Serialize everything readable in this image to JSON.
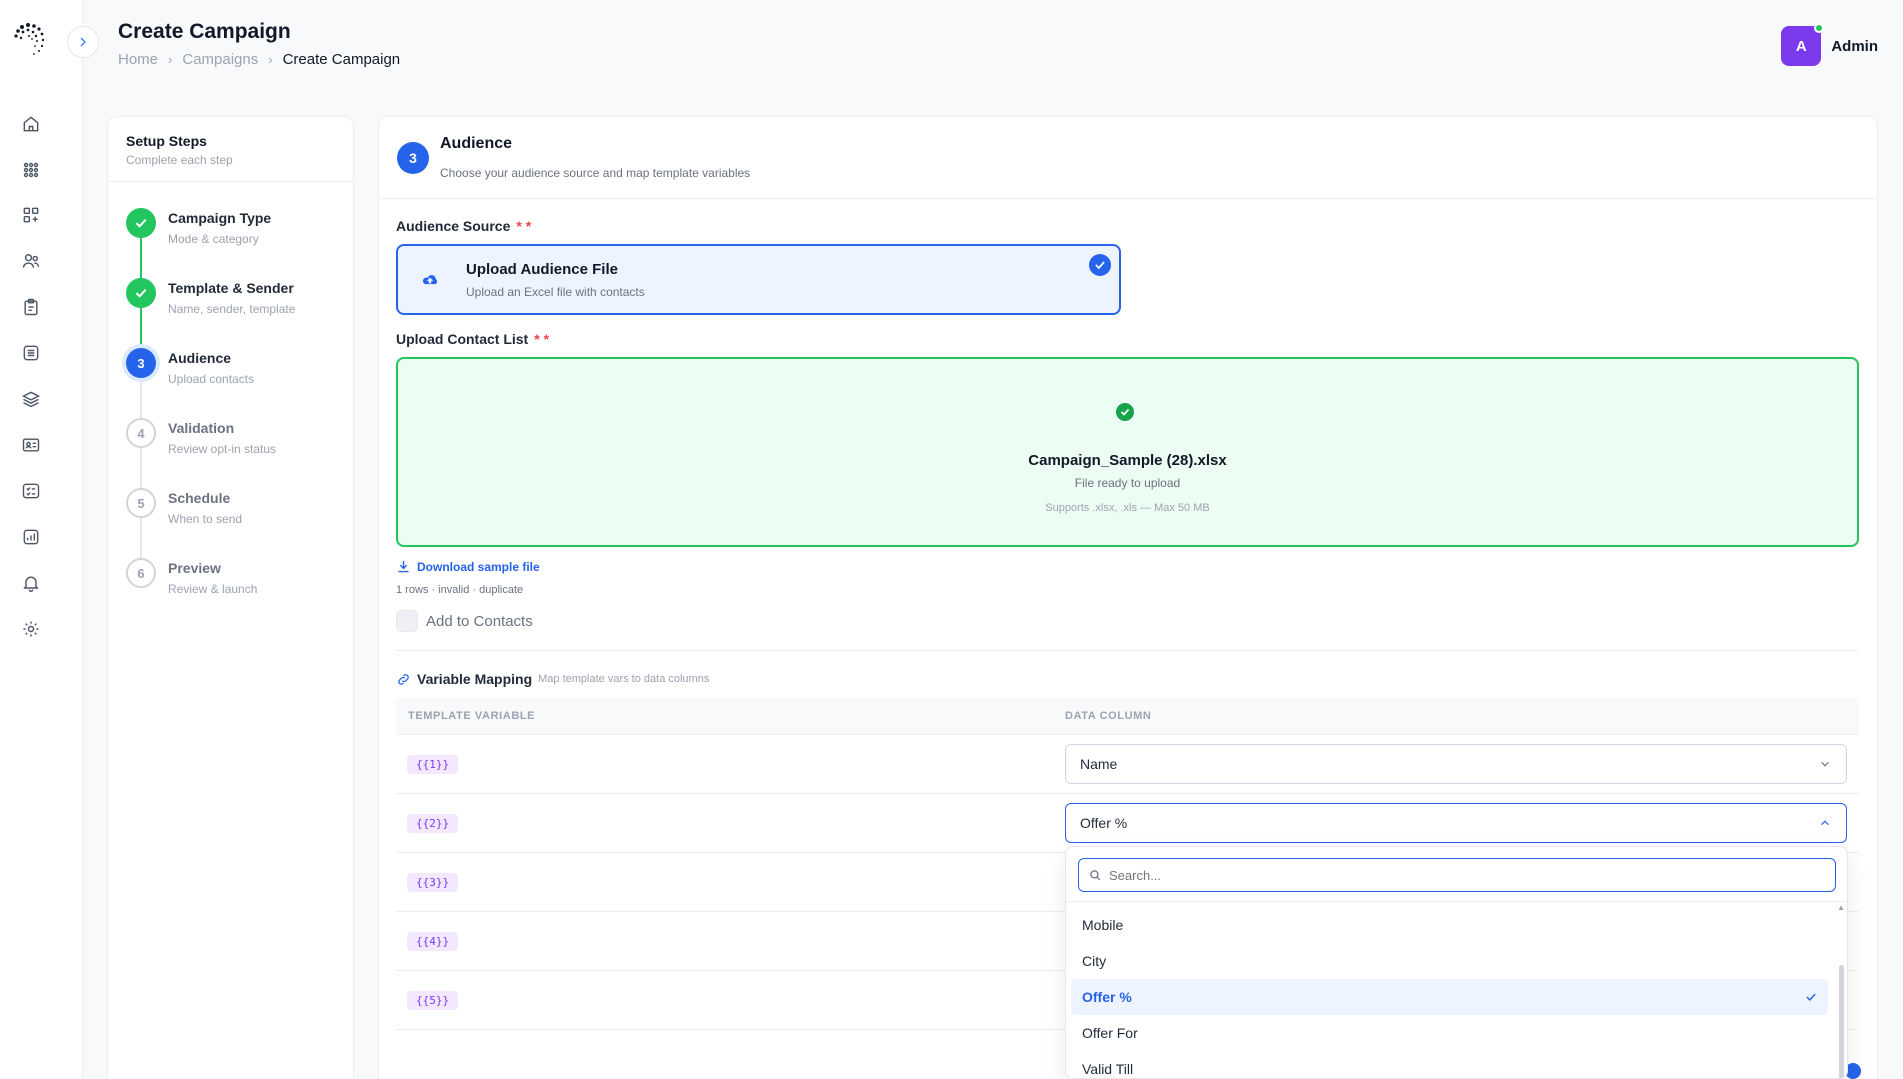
{
  "header": {
    "title": "Create Campaign",
    "breadcrumb": [
      "Home",
      "Campaigns",
      "Create Campaign"
    ],
    "user": {
      "initial": "A",
      "name": "Admin"
    }
  },
  "sidebar_icons": [
    "home-icon",
    "apps-grid-icon",
    "widgets-add-icon",
    "users-icon",
    "clipboard-icon",
    "list-icon",
    "layers-icon",
    "contact-card-icon",
    "checklist-icon",
    "analytics-icon",
    "notification-bell-icon",
    "settings-gear-icon"
  ],
  "steps_panel": {
    "title": "Setup Steps",
    "subtitle": "Complete each step",
    "steps": [
      {
        "num": "1",
        "label": "Campaign Type",
        "sub": "Mode & category",
        "state": "done"
      },
      {
        "num": "2",
        "label": "Template & Sender",
        "sub": "Name, sender, template",
        "state": "done"
      },
      {
        "num": "3",
        "label": "Audience",
        "sub": "Upload contacts",
        "state": "active"
      },
      {
        "num": "4",
        "label": "Validation",
        "sub": "Review opt-in status",
        "state": "todo"
      },
      {
        "num": "5",
        "label": "Schedule",
        "sub": "When to send",
        "state": "todo"
      },
      {
        "num": "6",
        "label": "Preview",
        "sub": "Review & launch",
        "state": "todo"
      }
    ]
  },
  "audience": {
    "step_num": "3",
    "title": "Audience",
    "subtitle": "Choose your audience source and map template variables",
    "source_label": "Audience Source",
    "required_mark": "* *",
    "source_card": {
      "title": "Upload Audience File",
      "subtitle": "Upload an Excel file with contacts"
    },
    "upload_label": "Upload Contact List",
    "upload": {
      "file_name": "Campaign_Sample (28).xlsx",
      "status": "File ready to upload",
      "supports": "Supports .xlsx, .xls — Max 50 MB"
    },
    "download_link": "Download sample file",
    "rows_info": "1 rows · invalid · duplicate",
    "add_to_contacts": "Add to Contacts"
  },
  "variable_mapping": {
    "title": "Variable Mapping",
    "subtitle": "Map template vars to data columns",
    "col_template": "TEMPLATE VARIABLE",
    "col_data": "DATA COLUMN",
    "rows": [
      {
        "var": "{{1}}",
        "column": "Name"
      },
      {
        "var": "{{2}}",
        "column": "Offer %"
      },
      {
        "var": "{{3}}",
        "column": ""
      },
      {
        "var": "{{4}}",
        "column": ""
      },
      {
        "var": "{{5}}",
        "column": ""
      }
    ]
  },
  "dropdown": {
    "search_placeholder": "Search...",
    "options": [
      "Mobile",
      "City",
      "Offer %",
      "Offer For",
      "Valid Till"
    ],
    "selected": "Offer %"
  },
  "colors": {
    "primary": "#2563eb",
    "success": "#22c55e",
    "avatar": "#7c3aed",
    "required": "#ef4444"
  }
}
